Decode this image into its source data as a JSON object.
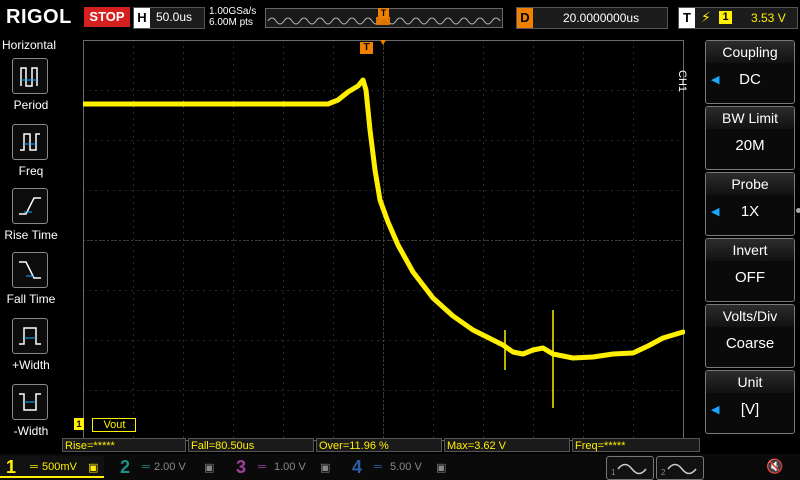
{
  "brand": "RIGOL",
  "run_state": "STOP",
  "horizontal": {
    "label": "H",
    "timebase": "50.0us"
  },
  "acquisition": {
    "sample_rate": "1.00GSa/s",
    "memory_depth": "6.00M pts"
  },
  "memory_marker": "T",
  "delay": {
    "label": "D",
    "value": "20.0000000us"
  },
  "trigger": {
    "label": "T",
    "channel": "1",
    "level": "3.53 V",
    "edge_icon": "rising-edge-icon"
  },
  "left_menu": {
    "title": "Horizontal",
    "items": [
      {
        "label": "Period",
        "icon": "period-icon"
      },
      {
        "label": "Freq",
        "icon": "frequency-icon"
      },
      {
        "label": "Rise Time",
        "icon": "rise-time-icon"
      },
      {
        "label": "Fall Time",
        "icon": "fall-time-icon"
      },
      {
        "label": "+Width",
        "icon": "positive-width-icon"
      },
      {
        "label": "-Width",
        "icon": "negative-width-icon"
      }
    ]
  },
  "right_menu": {
    "channel_tag": "CH1",
    "items": [
      {
        "title": "Coupling",
        "value": "DC",
        "has_arrow": true
      },
      {
        "title": "BW Limit",
        "value": "20M",
        "has_arrow": false
      },
      {
        "title": "Probe",
        "value": "1X",
        "has_arrow": true
      },
      {
        "title": "Invert",
        "value": "OFF",
        "has_arrow": false
      },
      {
        "title": "Volts/Div",
        "value": "Coarse",
        "has_arrow": false
      },
      {
        "title": "Unit",
        "value": "[V]",
        "has_arrow": true
      }
    ]
  },
  "trigger_marker": "T",
  "channel_label": "Vout",
  "measurements": [
    {
      "text": "Rise=*****"
    },
    {
      "text": "Fall=80.50us"
    },
    {
      "text": "Over=11.96 %"
    },
    {
      "text": "Max=3.62 V"
    },
    {
      "text": "Freq=*****"
    }
  ],
  "channels": [
    {
      "num": "1",
      "scale": "500mV",
      "active": true,
      "color": "#ffef00"
    },
    {
      "num": "2",
      "scale": "2.00 V",
      "active": false,
      "color": "#1f8f86"
    },
    {
      "num": "3",
      "scale": "1.00 V",
      "active": false,
      "color": "#a0409e"
    },
    {
      "num": "4",
      "scale": "5.00 V",
      "active": false,
      "color": "#2c5ea8"
    }
  ],
  "colors": {
    "trace": "#ffef00",
    "accent": "#f08000",
    "stop": "#d52020",
    "menu_arrow": "#17a8ff"
  }
}
